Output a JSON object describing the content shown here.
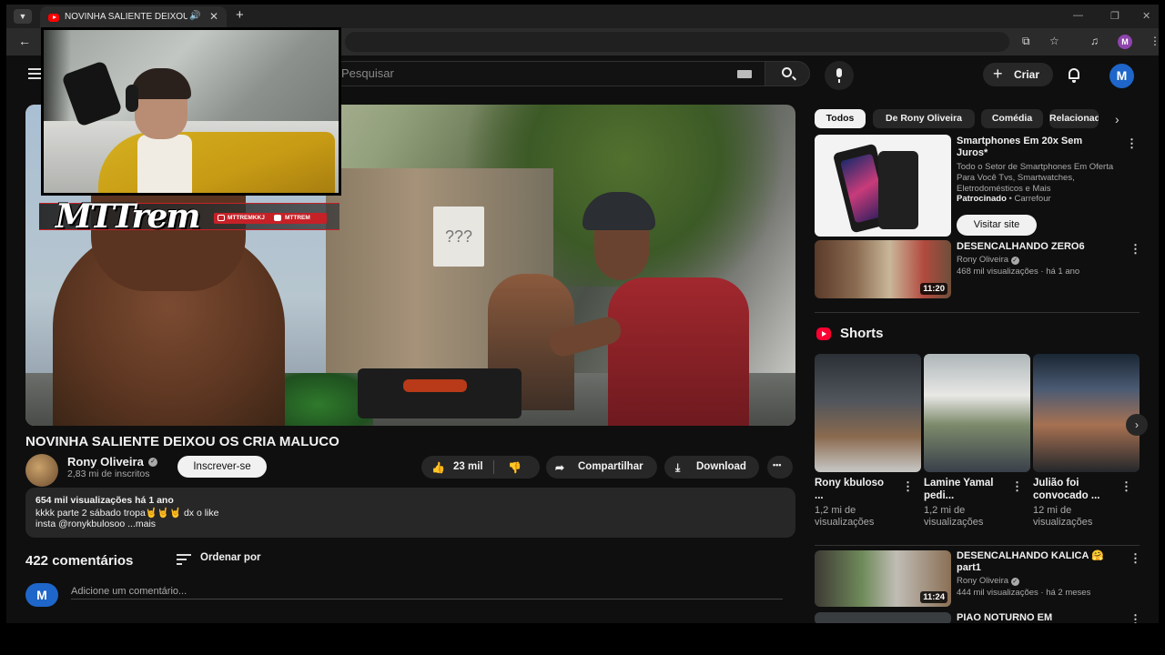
{
  "browser": {
    "tab_title": "NOVINHA SALIENTE DEIXOU",
    "tab_close": "✕",
    "new_tab": "+",
    "profile_initial": "M"
  },
  "masthead": {
    "search_placeholder": "Pesquisar",
    "create_label": "Criar",
    "avatar_initial": "M"
  },
  "overlay": {
    "logo_text": "MTTrem",
    "instagram_handle": "MTTREMKKJ",
    "youtube_handle": "MTTREM"
  },
  "video": {
    "title": "NOVINHA SALIENTE DEIXOU OS CRIA MALUCO",
    "channel": "Rony Oliveira",
    "subscribers": "2,83 mi de inscritos",
    "subscribe_label": "Inscrever-se",
    "likes": "23 mil",
    "share_label": "Compartilhar",
    "download_label": "Download",
    "more_label": "•••",
    "description": {
      "stats": "654 mil visualizações  há 1 ano",
      "line1": "kkkk parte 2 sábado tropa🤘🤘🤘 dx o like",
      "line2": "insta @ronykbulosoo ...mais"
    }
  },
  "comments": {
    "count": "422 comentários",
    "sort_label": "Ordenar por",
    "avatar_initial": "M",
    "input_placeholder": "Adicione um comentário..."
  },
  "sidebar": {
    "chips": [
      "Todos",
      "De Rony Oliveira",
      "Comédia",
      "Relacionados"
    ],
    "ad": {
      "title": "Smartphones Em 20x Sem Juros*",
      "description": "Todo o Setor de Smartphones Em Oferta Para Você Tvs, Smartwatches, Eletrodomésticos e Mais",
      "sponsored": "Patrocinado",
      "advertiser": "• Carrefour",
      "cta": "Visitar site"
    },
    "videos": [
      {
        "title": "DESENCALHANDO ZERO6",
        "channel": "Rony Oliveira",
        "meta": "468 mil visualizações · há 1 ano",
        "duration": "11:20"
      },
      {
        "title": "DESENCALHANDO KALICA 🤗 part1",
        "channel": "Rony Oliveira",
        "meta": "444 mil visualizações · há 2 meses",
        "duration": "11:24"
      },
      {
        "title": "PIAO NOTURNO EM",
        "channel": "",
        "meta": "",
        "duration": ""
      }
    ],
    "shorts_heading": "Shorts",
    "shorts": [
      {
        "title": "Rony kbuloso ...",
        "views": "1,2 mi de visualizações"
      },
      {
        "title": "Lamine Yamal pedi...",
        "views": "1,2 mi de visualizações"
      },
      {
        "title": "Julião foi convocado ...",
        "views": "12 mi de visualizações"
      }
    ]
  }
}
